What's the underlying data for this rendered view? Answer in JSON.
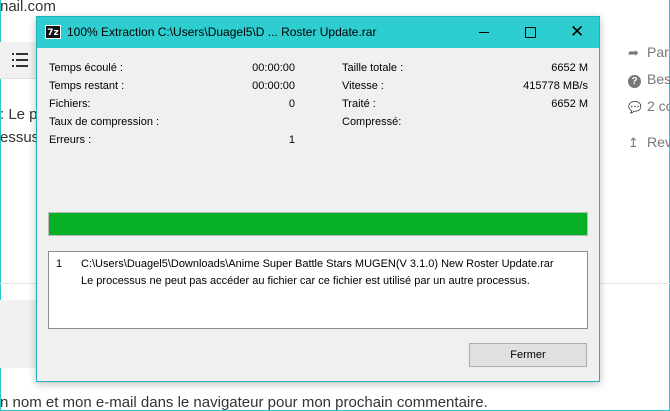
{
  "background": {
    "top_text": "nail.com",
    "left_text_1": ": Le p",
    "left_text_2": "essus",
    "bottom_text": "n nom et mon e-mail dans le navigateur pour mon prochain commentaire.",
    "sidebar": [
      {
        "icon": "share-icon",
        "glyph": "➦",
        "label": "Par"
      },
      {
        "icon": "question-icon",
        "glyph": "?",
        "label": "Bes"
      },
      {
        "icon": "comment-icon",
        "glyph": "💬",
        "label": "2 co"
      },
      {
        "icon": "arrow-up-icon",
        "glyph": "↥",
        "label": "Rev"
      }
    ]
  },
  "dialog": {
    "app_icon_text": "7z",
    "title": "100% Extraction C:\\Users\\Duagel5\\D ...  Roster Update.rar",
    "left_stats": [
      {
        "label": "Temps écoulé :",
        "value": "00:00:00"
      },
      {
        "label": "Temps restant :",
        "value": "00:00:00"
      },
      {
        "label": "Fichiers:",
        "value": "0"
      },
      {
        "label": "Taux de compression :",
        "value": ""
      },
      {
        "label": "Erreurs :",
        "value": "1"
      }
    ],
    "right_stats": [
      {
        "label": "Taille totale :",
        "value": "6652 M"
      },
      {
        "label": "Vitesse :",
        "value": "415778 MB/s"
      },
      {
        "label": "Traité :",
        "value": "6652 M"
      },
      {
        "label": "Compressé:",
        "value": ""
      }
    ],
    "progress_percent": 100,
    "progress_color": "#06b025",
    "log": {
      "number": "1",
      "path": "C:\\Users\\Duagel5\\Downloads\\Anime Super Battle Stars MUGEN(V 3.1.0) New Roster Update.rar",
      "message": "Le processus ne peut pas accéder au fichier car ce fichier est utilisé par un autre processus."
    },
    "close_button_label": "Fermer"
  }
}
